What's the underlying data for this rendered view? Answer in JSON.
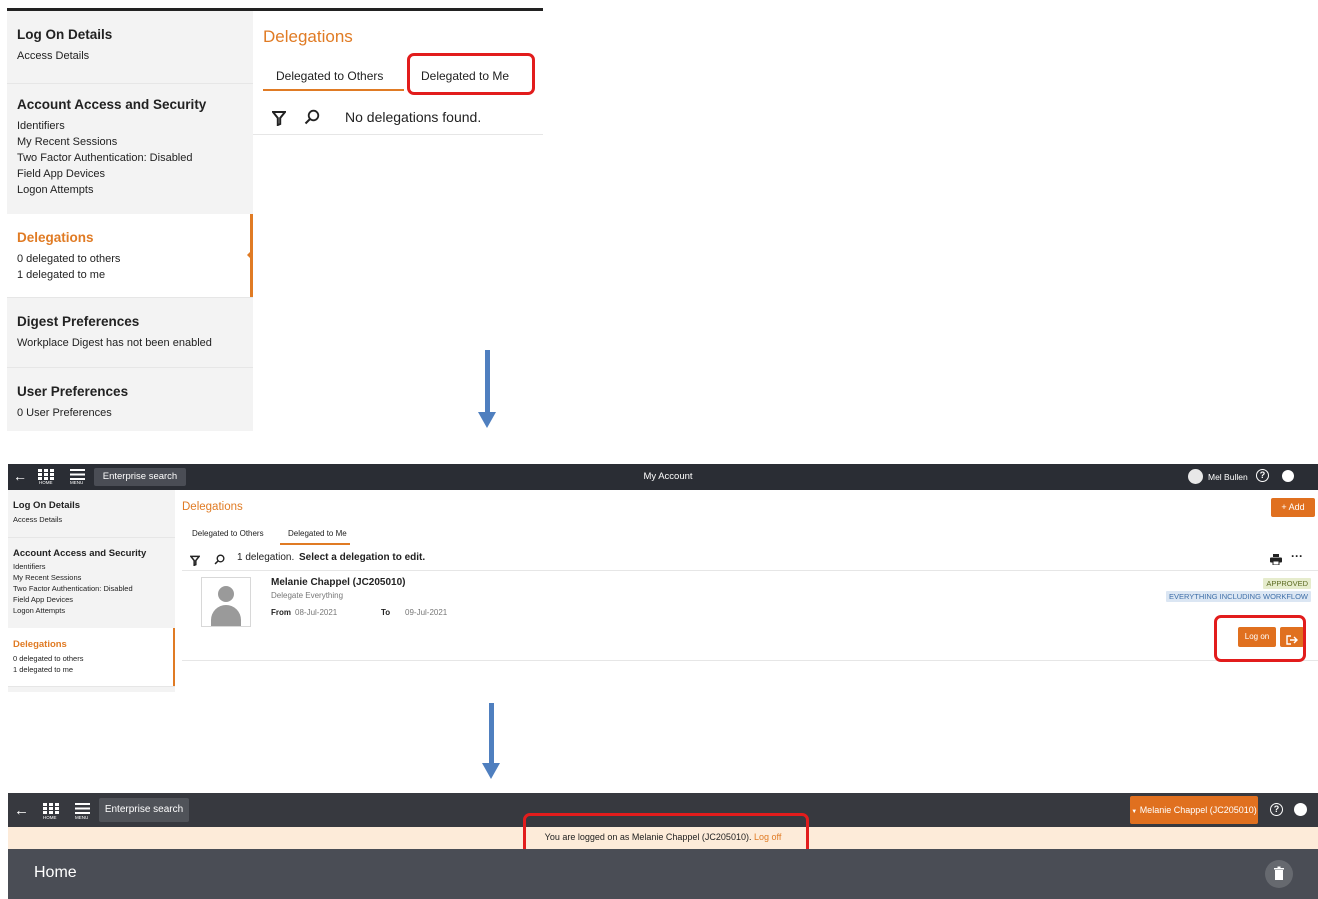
{
  "panel1": {
    "sidebar": [
      {
        "title": "Log On Details",
        "items": [
          "Access Details"
        ]
      },
      {
        "title": "Account Access and Security",
        "items": [
          "Identifiers",
          "My Recent Sessions",
          "Two Factor Authentication: Disabled",
          "Field App Devices",
          "Logon Attempts"
        ]
      },
      {
        "title": "Delegations",
        "items": [
          "0 delegated to others",
          "1 delegated to me"
        ]
      },
      {
        "title": "Digest Preferences",
        "items": [
          "Workplace Digest has not been enabled"
        ]
      },
      {
        "title": "User Preferences",
        "items": [
          "0 User Preferences"
        ]
      }
    ],
    "title": "Delegations",
    "tabs": [
      "Delegated to Others",
      "Delegated to Me"
    ],
    "empty_message": "No delegations found."
  },
  "panel2": {
    "topbar": {
      "home_label": "HOME",
      "menu_label": "MENU",
      "search_label": "Enterprise search",
      "page_title": "My Account",
      "user_name": "Mel Bullen"
    },
    "sidebar": [
      {
        "title": "Log On Details",
        "items": [
          "Access Details"
        ]
      },
      {
        "title": "Account Access and Security",
        "items": [
          "Identifiers",
          "My Recent Sessions",
          "Two Factor Authentication: Disabled",
          "Field App Devices",
          "Logon Attempts"
        ]
      },
      {
        "title": "Delegations",
        "items": [
          "0 delegated to others",
          "1 delegated to me"
        ]
      }
    ],
    "title": "Delegations",
    "add_label": "+ Add",
    "tabs": [
      "Delegated to Others",
      "Delegated to Me"
    ],
    "count_text": "1 delegation.",
    "instruction": "Select a delegation to edit.",
    "delegation": {
      "name": "Melanie Chappel (JC205010)",
      "type": "Delegate Everything",
      "from_label": "From",
      "from_date": "08-Jul-2021",
      "to_label": "To",
      "to_date": "09-Jul-2021",
      "status": "APPROVED",
      "scope": "EVERYTHING INCLUDING WORKFLOW",
      "logon_label": "Log on"
    }
  },
  "panel3": {
    "topbar": {
      "home_label": "HOME",
      "menu_label": "MENU",
      "search_label": "Enterprise search",
      "user_name": "Melanie Chappel (JC205010)"
    },
    "banner_text": "You are logged on as Melanie Chappel (JC205010).",
    "banner_link": "Log off",
    "home_title": "Home"
  },
  "colors": {
    "accent": "#e07b24",
    "highlight": "#e21c1c",
    "topbar": "#2a2d34",
    "arrow": "#4f7fbf",
    "approved_bg": "#e6eccd",
    "scope_bg": "#dbe6f3"
  }
}
